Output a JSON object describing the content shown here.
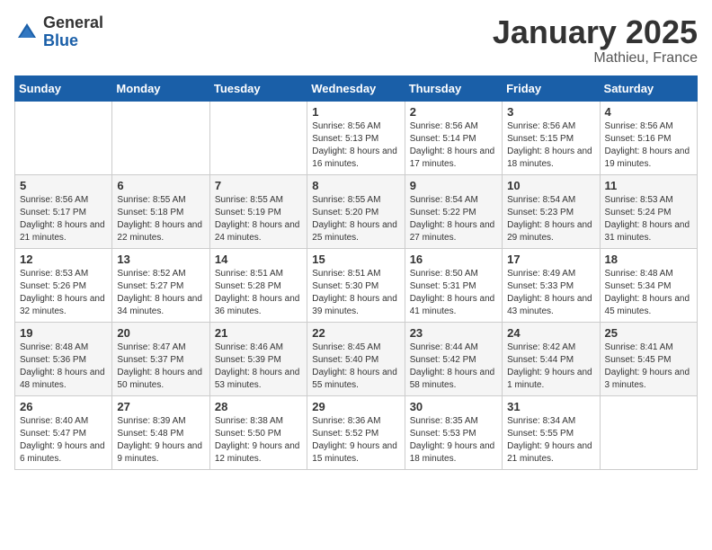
{
  "logo": {
    "general": "General",
    "blue": "Blue"
  },
  "title": {
    "month_year": "January 2025",
    "location": "Mathieu, France"
  },
  "weekdays": [
    "Sunday",
    "Monday",
    "Tuesday",
    "Wednesday",
    "Thursday",
    "Friday",
    "Saturday"
  ],
  "weeks": [
    [
      {
        "day": "",
        "sunrise": "",
        "sunset": "",
        "daylight": ""
      },
      {
        "day": "",
        "sunrise": "",
        "sunset": "",
        "daylight": ""
      },
      {
        "day": "",
        "sunrise": "",
        "sunset": "",
        "daylight": ""
      },
      {
        "day": "1",
        "sunrise": "Sunrise: 8:56 AM",
        "sunset": "Sunset: 5:13 PM",
        "daylight": "Daylight: 8 hours and 16 minutes."
      },
      {
        "day": "2",
        "sunrise": "Sunrise: 8:56 AM",
        "sunset": "Sunset: 5:14 PM",
        "daylight": "Daylight: 8 hours and 17 minutes."
      },
      {
        "day": "3",
        "sunrise": "Sunrise: 8:56 AM",
        "sunset": "Sunset: 5:15 PM",
        "daylight": "Daylight: 8 hours and 18 minutes."
      },
      {
        "day": "4",
        "sunrise": "Sunrise: 8:56 AM",
        "sunset": "Sunset: 5:16 PM",
        "daylight": "Daylight: 8 hours and 19 minutes."
      }
    ],
    [
      {
        "day": "5",
        "sunrise": "Sunrise: 8:56 AM",
        "sunset": "Sunset: 5:17 PM",
        "daylight": "Daylight: 8 hours and 21 minutes."
      },
      {
        "day": "6",
        "sunrise": "Sunrise: 8:55 AM",
        "sunset": "Sunset: 5:18 PM",
        "daylight": "Daylight: 8 hours and 22 minutes."
      },
      {
        "day": "7",
        "sunrise": "Sunrise: 8:55 AM",
        "sunset": "Sunset: 5:19 PM",
        "daylight": "Daylight: 8 hours and 24 minutes."
      },
      {
        "day": "8",
        "sunrise": "Sunrise: 8:55 AM",
        "sunset": "Sunset: 5:20 PM",
        "daylight": "Daylight: 8 hours and 25 minutes."
      },
      {
        "day": "9",
        "sunrise": "Sunrise: 8:54 AM",
        "sunset": "Sunset: 5:22 PM",
        "daylight": "Daylight: 8 hours and 27 minutes."
      },
      {
        "day": "10",
        "sunrise": "Sunrise: 8:54 AM",
        "sunset": "Sunset: 5:23 PM",
        "daylight": "Daylight: 8 hours and 29 minutes."
      },
      {
        "day": "11",
        "sunrise": "Sunrise: 8:53 AM",
        "sunset": "Sunset: 5:24 PM",
        "daylight": "Daylight: 8 hours and 31 minutes."
      }
    ],
    [
      {
        "day": "12",
        "sunrise": "Sunrise: 8:53 AM",
        "sunset": "Sunset: 5:26 PM",
        "daylight": "Daylight: 8 hours and 32 minutes."
      },
      {
        "day": "13",
        "sunrise": "Sunrise: 8:52 AM",
        "sunset": "Sunset: 5:27 PM",
        "daylight": "Daylight: 8 hours and 34 minutes."
      },
      {
        "day": "14",
        "sunrise": "Sunrise: 8:51 AM",
        "sunset": "Sunset: 5:28 PM",
        "daylight": "Daylight: 8 hours and 36 minutes."
      },
      {
        "day": "15",
        "sunrise": "Sunrise: 8:51 AM",
        "sunset": "Sunset: 5:30 PM",
        "daylight": "Daylight: 8 hours and 39 minutes."
      },
      {
        "day": "16",
        "sunrise": "Sunrise: 8:50 AM",
        "sunset": "Sunset: 5:31 PM",
        "daylight": "Daylight: 8 hours and 41 minutes."
      },
      {
        "day": "17",
        "sunrise": "Sunrise: 8:49 AM",
        "sunset": "Sunset: 5:33 PM",
        "daylight": "Daylight: 8 hours and 43 minutes."
      },
      {
        "day": "18",
        "sunrise": "Sunrise: 8:48 AM",
        "sunset": "Sunset: 5:34 PM",
        "daylight": "Daylight: 8 hours and 45 minutes."
      }
    ],
    [
      {
        "day": "19",
        "sunrise": "Sunrise: 8:48 AM",
        "sunset": "Sunset: 5:36 PM",
        "daylight": "Daylight: 8 hours and 48 minutes."
      },
      {
        "day": "20",
        "sunrise": "Sunrise: 8:47 AM",
        "sunset": "Sunset: 5:37 PM",
        "daylight": "Daylight: 8 hours and 50 minutes."
      },
      {
        "day": "21",
        "sunrise": "Sunrise: 8:46 AM",
        "sunset": "Sunset: 5:39 PM",
        "daylight": "Daylight: 8 hours and 53 minutes."
      },
      {
        "day": "22",
        "sunrise": "Sunrise: 8:45 AM",
        "sunset": "Sunset: 5:40 PM",
        "daylight": "Daylight: 8 hours and 55 minutes."
      },
      {
        "day": "23",
        "sunrise": "Sunrise: 8:44 AM",
        "sunset": "Sunset: 5:42 PM",
        "daylight": "Daylight: 8 hours and 58 minutes."
      },
      {
        "day": "24",
        "sunrise": "Sunrise: 8:42 AM",
        "sunset": "Sunset: 5:44 PM",
        "daylight": "Daylight: 9 hours and 1 minute."
      },
      {
        "day": "25",
        "sunrise": "Sunrise: 8:41 AM",
        "sunset": "Sunset: 5:45 PM",
        "daylight": "Daylight: 9 hours and 3 minutes."
      }
    ],
    [
      {
        "day": "26",
        "sunrise": "Sunrise: 8:40 AM",
        "sunset": "Sunset: 5:47 PM",
        "daylight": "Daylight: 9 hours and 6 minutes."
      },
      {
        "day": "27",
        "sunrise": "Sunrise: 8:39 AM",
        "sunset": "Sunset: 5:48 PM",
        "daylight": "Daylight: 9 hours and 9 minutes."
      },
      {
        "day": "28",
        "sunrise": "Sunrise: 8:38 AM",
        "sunset": "Sunset: 5:50 PM",
        "daylight": "Daylight: 9 hours and 12 minutes."
      },
      {
        "day": "29",
        "sunrise": "Sunrise: 8:36 AM",
        "sunset": "Sunset: 5:52 PM",
        "daylight": "Daylight: 9 hours and 15 minutes."
      },
      {
        "day": "30",
        "sunrise": "Sunrise: 8:35 AM",
        "sunset": "Sunset: 5:53 PM",
        "daylight": "Daylight: 9 hours and 18 minutes."
      },
      {
        "day": "31",
        "sunrise": "Sunrise: 8:34 AM",
        "sunset": "Sunset: 5:55 PM",
        "daylight": "Daylight: 9 hours and 21 minutes."
      },
      {
        "day": "",
        "sunrise": "",
        "sunset": "",
        "daylight": ""
      }
    ]
  ]
}
